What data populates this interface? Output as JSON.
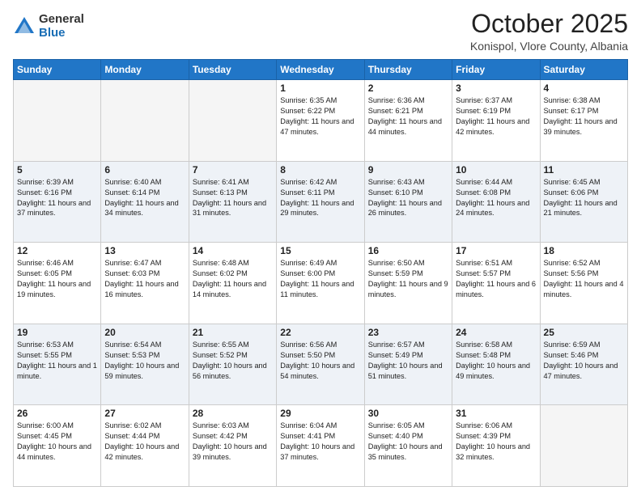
{
  "header": {
    "logo_general": "General",
    "logo_blue": "Blue",
    "month": "October 2025",
    "location": "Konispol, Vlore County, Albania"
  },
  "days_of_week": [
    "Sunday",
    "Monday",
    "Tuesday",
    "Wednesday",
    "Thursday",
    "Friday",
    "Saturday"
  ],
  "weeks": [
    [
      {
        "num": "",
        "info": ""
      },
      {
        "num": "",
        "info": ""
      },
      {
        "num": "",
        "info": ""
      },
      {
        "num": "1",
        "info": "Sunrise: 6:35 AM\nSunset: 6:22 PM\nDaylight: 11 hours and 47 minutes."
      },
      {
        "num": "2",
        "info": "Sunrise: 6:36 AM\nSunset: 6:21 PM\nDaylight: 11 hours and 44 minutes."
      },
      {
        "num": "3",
        "info": "Sunrise: 6:37 AM\nSunset: 6:19 PM\nDaylight: 11 hours and 42 minutes."
      },
      {
        "num": "4",
        "info": "Sunrise: 6:38 AM\nSunset: 6:17 PM\nDaylight: 11 hours and 39 minutes."
      }
    ],
    [
      {
        "num": "5",
        "info": "Sunrise: 6:39 AM\nSunset: 6:16 PM\nDaylight: 11 hours and 37 minutes."
      },
      {
        "num": "6",
        "info": "Sunrise: 6:40 AM\nSunset: 6:14 PM\nDaylight: 11 hours and 34 minutes."
      },
      {
        "num": "7",
        "info": "Sunrise: 6:41 AM\nSunset: 6:13 PM\nDaylight: 11 hours and 31 minutes."
      },
      {
        "num": "8",
        "info": "Sunrise: 6:42 AM\nSunset: 6:11 PM\nDaylight: 11 hours and 29 minutes."
      },
      {
        "num": "9",
        "info": "Sunrise: 6:43 AM\nSunset: 6:10 PM\nDaylight: 11 hours and 26 minutes."
      },
      {
        "num": "10",
        "info": "Sunrise: 6:44 AM\nSunset: 6:08 PM\nDaylight: 11 hours and 24 minutes."
      },
      {
        "num": "11",
        "info": "Sunrise: 6:45 AM\nSunset: 6:06 PM\nDaylight: 11 hours and 21 minutes."
      }
    ],
    [
      {
        "num": "12",
        "info": "Sunrise: 6:46 AM\nSunset: 6:05 PM\nDaylight: 11 hours and 19 minutes."
      },
      {
        "num": "13",
        "info": "Sunrise: 6:47 AM\nSunset: 6:03 PM\nDaylight: 11 hours and 16 minutes."
      },
      {
        "num": "14",
        "info": "Sunrise: 6:48 AM\nSunset: 6:02 PM\nDaylight: 11 hours and 14 minutes."
      },
      {
        "num": "15",
        "info": "Sunrise: 6:49 AM\nSunset: 6:00 PM\nDaylight: 11 hours and 11 minutes."
      },
      {
        "num": "16",
        "info": "Sunrise: 6:50 AM\nSunset: 5:59 PM\nDaylight: 11 hours and 9 minutes."
      },
      {
        "num": "17",
        "info": "Sunrise: 6:51 AM\nSunset: 5:57 PM\nDaylight: 11 hours and 6 minutes."
      },
      {
        "num": "18",
        "info": "Sunrise: 6:52 AM\nSunset: 5:56 PM\nDaylight: 11 hours and 4 minutes."
      }
    ],
    [
      {
        "num": "19",
        "info": "Sunrise: 6:53 AM\nSunset: 5:55 PM\nDaylight: 11 hours and 1 minute."
      },
      {
        "num": "20",
        "info": "Sunrise: 6:54 AM\nSunset: 5:53 PM\nDaylight: 10 hours and 59 minutes."
      },
      {
        "num": "21",
        "info": "Sunrise: 6:55 AM\nSunset: 5:52 PM\nDaylight: 10 hours and 56 minutes."
      },
      {
        "num": "22",
        "info": "Sunrise: 6:56 AM\nSunset: 5:50 PM\nDaylight: 10 hours and 54 minutes."
      },
      {
        "num": "23",
        "info": "Sunrise: 6:57 AM\nSunset: 5:49 PM\nDaylight: 10 hours and 51 minutes."
      },
      {
        "num": "24",
        "info": "Sunrise: 6:58 AM\nSunset: 5:48 PM\nDaylight: 10 hours and 49 minutes."
      },
      {
        "num": "25",
        "info": "Sunrise: 6:59 AM\nSunset: 5:46 PM\nDaylight: 10 hours and 47 minutes."
      }
    ],
    [
      {
        "num": "26",
        "info": "Sunrise: 6:00 AM\nSunset: 4:45 PM\nDaylight: 10 hours and 44 minutes."
      },
      {
        "num": "27",
        "info": "Sunrise: 6:02 AM\nSunset: 4:44 PM\nDaylight: 10 hours and 42 minutes."
      },
      {
        "num": "28",
        "info": "Sunrise: 6:03 AM\nSunset: 4:42 PM\nDaylight: 10 hours and 39 minutes."
      },
      {
        "num": "29",
        "info": "Sunrise: 6:04 AM\nSunset: 4:41 PM\nDaylight: 10 hours and 37 minutes."
      },
      {
        "num": "30",
        "info": "Sunrise: 6:05 AM\nSunset: 4:40 PM\nDaylight: 10 hours and 35 minutes."
      },
      {
        "num": "31",
        "info": "Sunrise: 6:06 AM\nSunset: 4:39 PM\nDaylight: 10 hours and 32 minutes."
      },
      {
        "num": "",
        "info": ""
      }
    ]
  ]
}
